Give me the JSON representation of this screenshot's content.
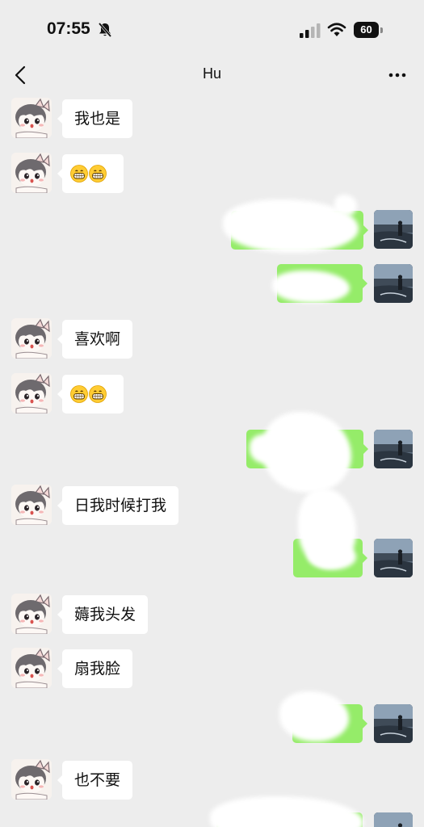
{
  "status_bar": {
    "time": "07:55",
    "battery": "60",
    "icons": [
      "bell-slash-icon",
      "signal-icon",
      "wifi-icon",
      "battery-icon"
    ]
  },
  "nav": {
    "title": "Hu",
    "back_icon": "chevron-left-icon",
    "more_icon": "more-dots-icon"
  },
  "messages": [
    {
      "side": "left",
      "text": "我也是"
    },
    {
      "side": "left",
      "emoji": "grinning-face-emoji",
      "count": 2
    },
    {
      "side": "right",
      "text": ""
    },
    {
      "side": "right",
      "text": ""
    },
    {
      "side": "left",
      "text": "喜欢啊"
    },
    {
      "side": "left",
      "emoji": "grinning-face-emoji",
      "count": 2
    },
    {
      "side": "right",
      "text": ""
    },
    {
      "side": "left",
      "text": "日我时候打我"
    },
    {
      "side": "right",
      "text": ""
    },
    {
      "side": "left",
      "text": "薅我头发"
    },
    {
      "side": "left",
      "text": "扇我脸"
    },
    {
      "side": "right",
      "text": ""
    },
    {
      "side": "left",
      "text": "也不要"
    },
    {
      "side": "right",
      "text": ""
    }
  ],
  "colors": {
    "background": "#ededed",
    "outgoing_bubble": "#95ec69",
    "incoming_bubble": "#ffffff"
  }
}
